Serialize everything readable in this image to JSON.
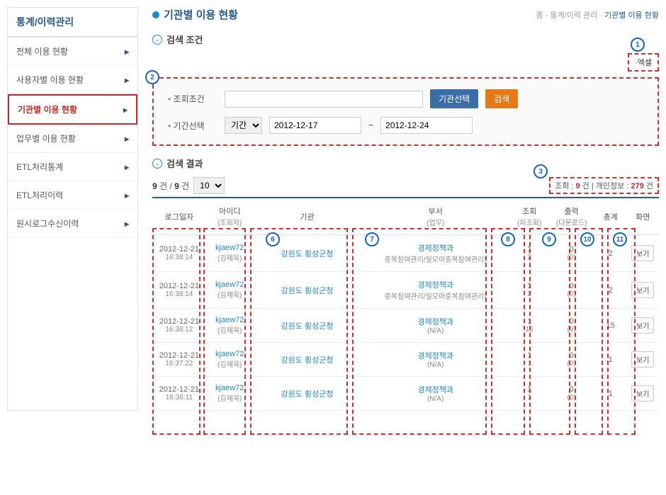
{
  "sidebar": {
    "title": "통계/이력관리",
    "items": [
      {
        "label": "전체 이용 현황"
      },
      {
        "label": "사용자별 이용 현황"
      },
      {
        "label": "기관별 이용 현황",
        "active": true
      },
      {
        "label": "업무별 이용 현황"
      },
      {
        "label": "ETL처리통계"
      },
      {
        "label": "ETL처리이력"
      },
      {
        "label": "원시로그수신이력"
      }
    ]
  },
  "page": {
    "title": "기관별 이용 현황",
    "breadcrumb_home": "홈",
    "breadcrumb_mid": "통계/이력 관리",
    "breadcrumb_current": "기관별 이용 현황"
  },
  "search_section": {
    "title": "검색 조건",
    "excel_label": "·엑셀",
    "cond_label": "조회조건",
    "org_select_btn": "기관선택",
    "search_btn": "검색",
    "period_label": "기간선택",
    "period_select": "기간",
    "date_from": "2012-12-17",
    "date_to": "2012-12-24",
    "tilde": "~"
  },
  "results_section": {
    "title": "검색 결과",
    "count_text_prefix": "9",
    "count_text_mid": " 건 / ",
    "count_text_suffix": "9",
    "count_text_end": " 건",
    "page_size": "10",
    "summary_view_label": "조회 : ",
    "summary_view_num": "9",
    "summary_view_unit": " 건",
    "summary_sep": "   |   ",
    "summary_pi_label": "개인정보 : ",
    "summary_pi_num": "279",
    "summary_pi_unit": " 건"
  },
  "table": {
    "headers": {
      "log": "로그일자",
      "id": "아이디",
      "id_sub": "(조회자)",
      "org": "기관",
      "dept": "부서",
      "dept_sub": "(업무)",
      "view": "조회",
      "view_sub": "(피조회)",
      "dl": "출력",
      "dl_sub": "(다운로드)",
      "sum": "총계",
      "screen": "화면"
    },
    "rows": [
      {
        "date": "2012-12-21",
        "time": "16:38:14",
        "id": "kjaew72",
        "id_sub": "(김재욱)",
        "org": "강원도 횡성군청",
        "dept": "경제정책과",
        "dept_sub": "중복참여관리/일모아중복참여관리)",
        "v1": "1",
        "v2": "2",
        "d1": "0",
        "d2": "(0)",
        "sum": "2",
        "btn": "보기"
      },
      {
        "date": "2012-12-21",
        "time": "16:38:14",
        "id": "kjaew72",
        "id_sub": "(김재욱)",
        "org": "강원도 횡성군청",
        "dept": "경제정책과",
        "dept_sub": "중복참여관리/일모아중복참여관리)",
        "v1": "1",
        "v2": "2",
        "d1": "0",
        "d2": "(0)",
        "sum": "2",
        "btn": "보기"
      },
      {
        "date": "2012-12-21",
        "time": "16:38:12",
        "id": "kjaew72",
        "id_sub": "(김재욱)",
        "org": "강원도 횡성군청",
        "dept": "경제정책과",
        "dept_sub": "(N/A)",
        "v1": "1",
        "v2": "15",
        "d1": "0",
        "d2": "(0)",
        "sum": "15",
        "btn": "보기"
      },
      {
        "date": "2012-12-21",
        "time": "16:37:22",
        "id": "kjaew72",
        "id_sub": "(김재욱)",
        "org": "강원도 횡성군청",
        "dept": "경제정책과",
        "dept_sub": "(N/A)",
        "v1": "1",
        "v2": "1",
        "d1": "0",
        "d2": "(0)",
        "sum": "1",
        "btn": "보기"
      },
      {
        "date": "2012-12-21",
        "time": "16:36:11",
        "id": "kjaew72",
        "id_sub": "(김재욱)",
        "org": "강원도 횡성군청",
        "dept": "경제정책과",
        "dept_sub": "(N/A)",
        "v1": "1",
        "v2": "1",
        "d1": "0",
        "d2": "(0)",
        "sum": "1",
        "btn": "보기"
      }
    ]
  },
  "annotations": {
    "1": "1",
    "2": "2",
    "3": "3",
    "6": "6",
    "7": "7",
    "8": "8",
    "9": "9",
    "10": "10",
    "11": "11"
  }
}
